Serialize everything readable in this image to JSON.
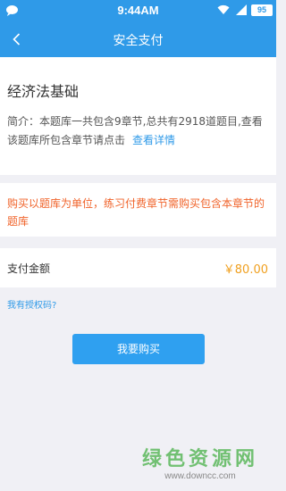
{
  "status_bar": {
    "time": "9:44AM",
    "battery": "95"
  },
  "header": {
    "title": "安全支付"
  },
  "course": {
    "title": "经济法基础",
    "description": "简介：本题库一共包含9章节,总共有2918道题目,查看该题库所包含章节请点击",
    "detail_link": "查看详情"
  },
  "notice": {
    "text": "购买以题库为单位，练习付费章节需购买包含本章节的题库"
  },
  "payment": {
    "amount_label": "支付金额",
    "amount_value": "￥80.00"
  },
  "auth_code_link": "我有授权码?",
  "buy_button_label": "我要购买",
  "watermark": {
    "title": "绿色资源网",
    "url": "www.downcc.com"
  },
  "colors": {
    "brand": "#2f9ae8",
    "notice": "#f0632a",
    "price": "#f0a020"
  }
}
